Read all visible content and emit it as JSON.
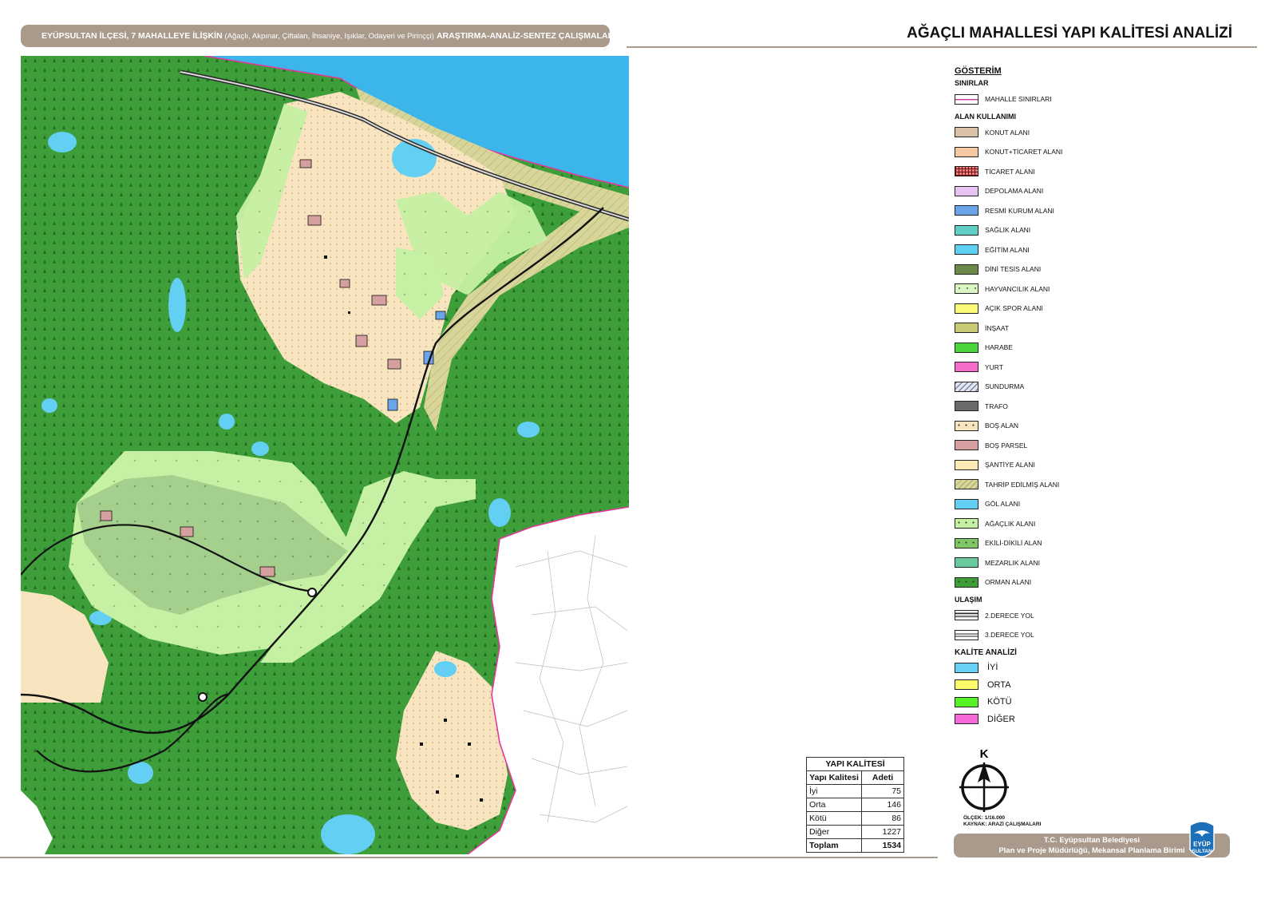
{
  "header": {
    "lead": "EYÜPSULTAN İLÇESİ, 7 MAHALLEYE İLİŞKİN",
    "sub": "(Ağaçlı, Akpınar, Çiftalan, İhsaniye, Işıklar, Odayeri ve Pirinççi)",
    "tail": "ARAŞTIRMA-ANALİZ-SENTEZ ÇALIŞMALARI"
  },
  "title": "AĞAÇLI MAHALLESİ YAPI KALİTESİ ANALİZİ",
  "legend": {
    "heading": "GÖSTERİM",
    "sections": [
      {
        "title": "SINIRLAR",
        "items": [
          {
            "label": "MAHALLE SINIRLARI",
            "color": "#ffffff",
            "pattern": "boundary"
          }
        ]
      },
      {
        "title": "ALAN KULLANIMI",
        "items": [
          {
            "label": "KONUT ALANI",
            "color": "#d9c2a6",
            "pattern": "solid"
          },
          {
            "label": "KONUT+TİCARET ALANI",
            "color": "#f6c9a2",
            "pattern": "solid"
          },
          {
            "label": "TİCARET ALANI",
            "color": "#ef7f7f",
            "pattern": "grid"
          },
          {
            "label": "DEPOLAMA ALANI",
            "color": "#e8c4f4",
            "pattern": "solid"
          },
          {
            "label": "RESMİ KURUM ALANI",
            "color": "#6aa5ea",
            "pattern": "solid"
          },
          {
            "label": "SAĞLIK ALANI",
            "color": "#5fcfc5",
            "pattern": "solid"
          },
          {
            "label": "EĞİTİM ALANI",
            "color": "#5ed0f2",
            "pattern": "solid"
          },
          {
            "label": "DİNİ TESİS ALANI",
            "color": "#6e8a4a",
            "pattern": "solid"
          },
          {
            "label": "HAYVANCILIK ALANI",
            "color": "#d9f5c4",
            "pattern": "tick"
          },
          {
            "label": "AÇIK SPOR ALANI",
            "color": "#fafa78",
            "pattern": "solid"
          },
          {
            "label": "İNŞAAT",
            "color": "#c9c873",
            "pattern": "solid"
          },
          {
            "label": "HARABE",
            "color": "#49d63b",
            "pattern": "solid"
          },
          {
            "label": "YURT",
            "color": "#f36cc9",
            "pattern": "solid"
          },
          {
            "label": "SUNDURMA",
            "color": "#e4e6ee",
            "pattern": "hatch"
          },
          {
            "label": "TRAFO",
            "color": "#6b6b6b",
            "pattern": "solid"
          },
          {
            "label": "BOŞ ALAN",
            "color": "#f8e5c0",
            "pattern": "dots"
          },
          {
            "label": "BOŞ PARSEL",
            "color": "#d7a0a0",
            "pattern": "solid"
          },
          {
            "label": "ŞANTİYE ALANI",
            "color": "#fbe9b4",
            "pattern": "solid"
          },
          {
            "label": "TAHRİP EDİLMİŞ ALANI",
            "color": "#d8d59b",
            "pattern": "diag"
          },
          {
            "label": "GÖL ALANI",
            "color": "#62cff3",
            "pattern": "solid"
          },
          {
            "label": "AĞAÇLIK ALANI",
            "color": "#c6f0a4",
            "pattern": "dots"
          },
          {
            "label": "EKİLİ-DİKİLİ ALAN",
            "color": "#7fc665",
            "pattern": "dots"
          },
          {
            "label": "MEZARLIK ALANI",
            "color": "#6acb9f",
            "pattern": "solid"
          },
          {
            "label": "ORMAN ALANI",
            "color": "#3d9e3a",
            "pattern": "dots"
          }
        ]
      },
      {
        "title": "ULAŞIM",
        "items": [
          {
            "label": "2.DERECE YOL",
            "color": "#ffffff",
            "pattern": "road2"
          },
          {
            "label": "3.DERECE YOL",
            "color": "#ffffff",
            "pattern": "road3"
          }
        ]
      }
    ],
    "quality_title": "KALİTE ANALİZİ",
    "quality_items": [
      {
        "label": "İYİ",
        "color": "#67d2f6"
      },
      {
        "label": "ORTA",
        "color": "#fafa6a"
      },
      {
        "label": "KÖTÜ",
        "color": "#55f224"
      },
      {
        "label": "DİĞER",
        "color": "#f56ad8"
      }
    ]
  },
  "quality_table": {
    "caption": "YAPI KALİTESİ",
    "headers": [
      "Yapı Kalitesi",
      "Adeti"
    ],
    "rows": [
      {
        "label": "İyi",
        "count": "75"
      },
      {
        "label": "Orta",
        "count": "146"
      },
      {
        "label": "Kötü",
        "count": "86"
      },
      {
        "label": "Diğer",
        "count": "1227"
      }
    ],
    "total": {
      "label": "Toplam",
      "count": "1534"
    }
  },
  "compass_letter": "K",
  "scale": "ÖLÇEK: 1/16.000",
  "source": "KAYNAK: ARAZİ ÇALIŞMALARI",
  "footer": {
    "line1": "T.C. Eyüpsultan Belediyesi",
    "line2": "Plan ve Proje Müdürlüğü, Mekansal Planlama Birimi"
  },
  "logo_text": [
    "EYÜP",
    "SULTAN"
  ],
  "colors": {
    "accent": "#a99a8c",
    "forest": "#3d9e3a",
    "grove": "#c6f0a4",
    "cultivated": "#a5cf8c",
    "vacant": "#f8e5c0",
    "lake": "#62cff3",
    "sea": "#3cb6ea",
    "boundary": "#e3399b"
  }
}
